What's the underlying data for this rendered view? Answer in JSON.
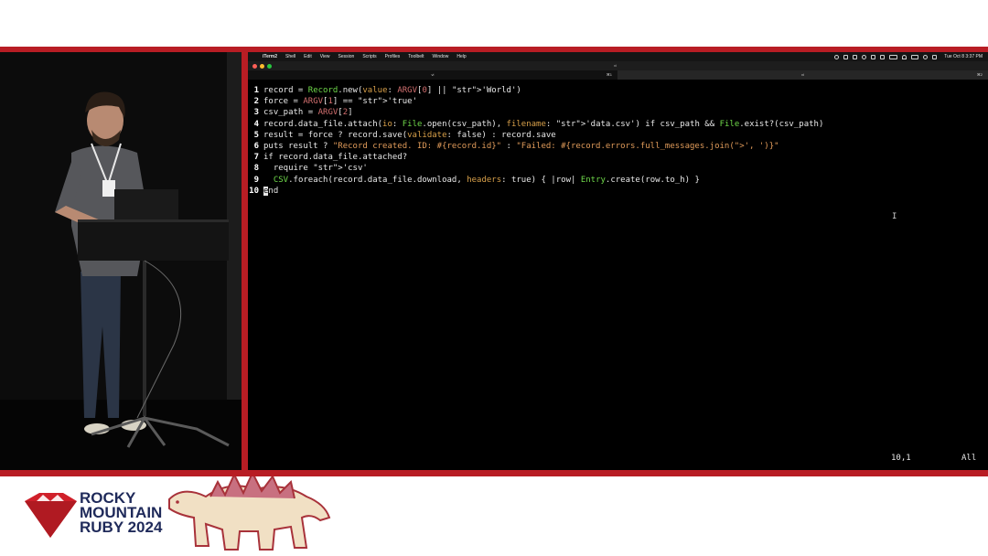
{
  "menubar": {
    "items": [
      "iTerm2",
      "Shell",
      "Edit",
      "View",
      "Session",
      "Scripts",
      "Profiles",
      "Toolbelt",
      "Window",
      "Help"
    ],
    "clock": "Tue Oct 8 3:37 PM"
  },
  "window": {
    "title": "vi",
    "tab1": {
      "title": "vi",
      "shortcut": "⌘1"
    },
    "tab2": {
      "title": "vi",
      "shortcut": "⌘2"
    }
  },
  "editor": {
    "lines": [
      {
        "n": "1",
        "text": "record = Record.new(value: ARGV[0] || 'World')"
      },
      {
        "n": "2",
        "text": "force = ARGV[1] == 'true'"
      },
      {
        "n": "3",
        "text": "csv_path = ARGV[2]"
      },
      {
        "n": "4",
        "text": "record.data_file.attach(io: File.open(csv_path), filename: 'data.csv') if csv_path && File.exist?(csv_path)"
      },
      {
        "n": "5",
        "text": "result = force ? record.save(validate: false) : record.save"
      },
      {
        "n": "6",
        "text": "puts result ? \"Record created. ID: #{record.id}\" : \"Failed: #{record.errors.full_messages.join(', ')}\""
      },
      {
        "n": "7",
        "text": "if record.data_file.attached?"
      },
      {
        "n": "8",
        "text": "  require 'csv'"
      },
      {
        "n": "9",
        "text": "  CSV.foreach(record.data_file.download, headers: true) { |row| Entry.create(row.to_h) }"
      },
      {
        "n": "10",
        "text": "end"
      }
    ],
    "position": "10,1",
    "scroll": "All"
  },
  "branding": {
    "line1": "ROCKY",
    "line2": "MOUNTAIN",
    "line3": "RUBY 2024",
    "colors": {
      "ruby": "#d0202a",
      "text": "#1f2a5a"
    }
  },
  "colors": {
    "band": "#b81d24"
  }
}
